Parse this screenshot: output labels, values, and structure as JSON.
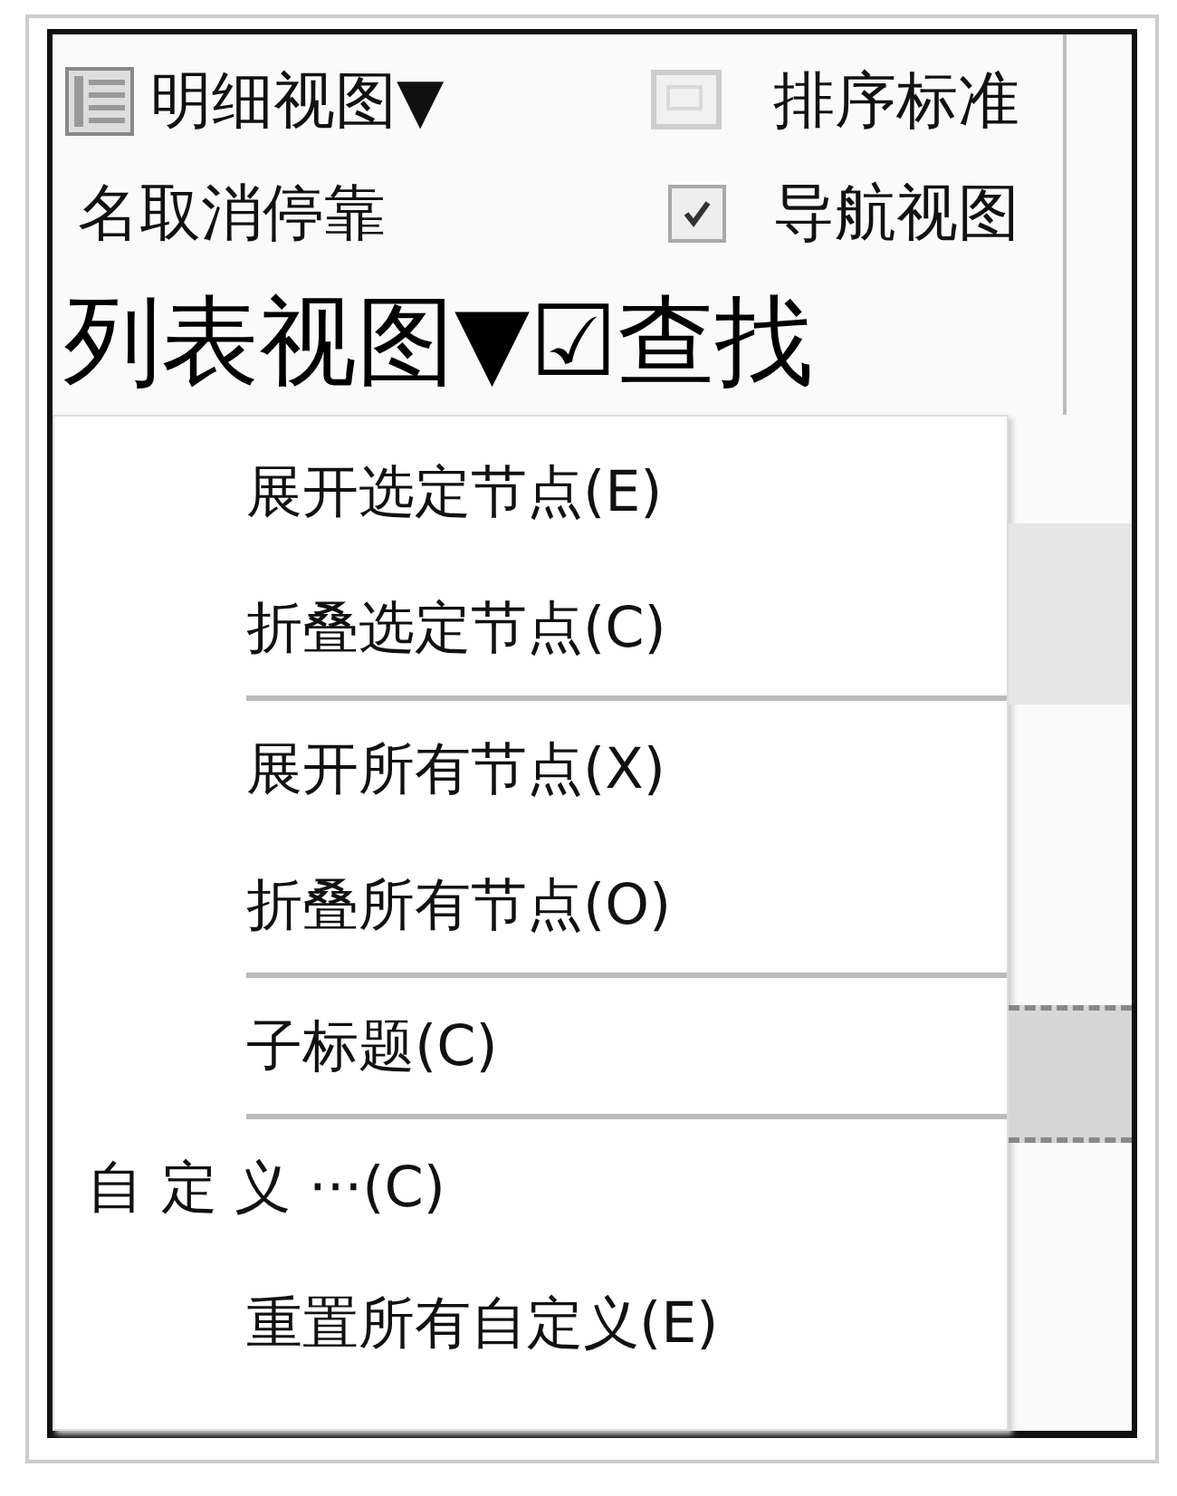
{
  "toolbar_rows": [
    [
      {
        "kind": "dropdown",
        "label": "明细视图",
        "caret": "▼"
      },
      {
        "kind": "button",
        "label": "排序标准"
      }
    ],
    [
      {
        "kind": "button",
        "label": "名取消停靠"
      },
      {
        "kind": "check",
        "label": "导航视图",
        "checked": true
      }
    ],
    [
      {
        "kind": "large-dropdown",
        "label": "列表视图",
        "caret": "▼"
      },
      {
        "kind": "large-check",
        "box": "☑",
        "label": "查找"
      }
    ]
  ],
  "menu": {
    "sections": [
      [
        {
          "kind": "item",
          "label": "展开选定节点(E)"
        },
        {
          "kind": "item",
          "label": "折叠选定节点(C)"
        }
      ],
      [
        {
          "kind": "item",
          "label": "展开所有节点(X)"
        },
        {
          "kind": "item",
          "label": "折叠所有节点(O)"
        }
      ],
      [
        {
          "kind": "item",
          "label": "子标题(C)"
        }
      ],
      [
        {
          "kind": "outdented",
          "label": "自 定 义 ···(C)"
        },
        {
          "kind": "item",
          "label": "重置所有自定义(E)"
        }
      ]
    ]
  }
}
